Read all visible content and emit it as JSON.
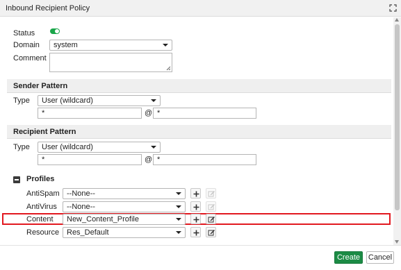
{
  "window": {
    "title": "Inbound Recipient Policy",
    "maximize_icon": "maximize-icon"
  },
  "form": {
    "status_label": "Status",
    "domain_label": "Domain",
    "domain_value": "system",
    "comment_label": "Comment",
    "comment_value": ""
  },
  "sender": {
    "title": "Sender Pattern",
    "type_label": "Type",
    "type_value": "User (wildcard)",
    "local_value": "*",
    "at": "@",
    "domain_value": "*"
  },
  "recipient": {
    "title": "Recipient Pattern",
    "type_label": "Type",
    "type_value": "User (wildcard)",
    "local_value": "*",
    "at": "@",
    "domain_value": "*"
  },
  "profiles": {
    "title": "Profiles",
    "antispam_label": "AntiSpam",
    "antispam_value": "--None--",
    "antivirus_label": "AntiVirus",
    "antivirus_value": "--None--",
    "content_label": "Content",
    "content_value": "New_Content_Profile",
    "resource_label": "Resource",
    "resource_value": "Res_Default"
  },
  "footer": {
    "create_label": "Create",
    "cancel_label": "Cancel"
  },
  "colors": {
    "accent_green": "#1c8b45",
    "toggle_on": "#1aa64a",
    "highlight_red": "#e2181f"
  }
}
